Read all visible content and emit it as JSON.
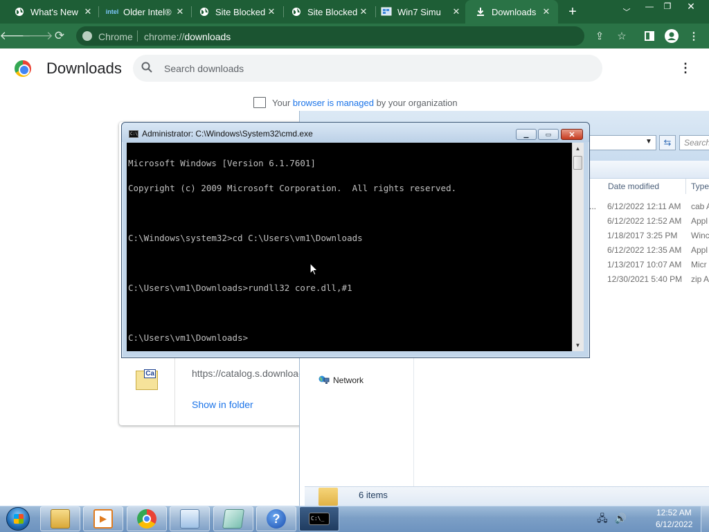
{
  "browser": {
    "tabs": [
      {
        "title": "What's New",
        "favicon": "globe-icon",
        "active": false
      },
      {
        "title": "Older Intel®",
        "favicon": "intel-icon",
        "active": false
      },
      {
        "title": "Site Blocked",
        "favicon": "globe-icon",
        "active": false
      },
      {
        "title": "Site Blocked",
        "favicon": "globe-icon",
        "active": false
      },
      {
        "title": "Win7 Simu",
        "favicon": "win7-icon",
        "active": false
      },
      {
        "title": "Downloads",
        "favicon": "download-icon",
        "active": true
      }
    ],
    "new_tab": "+",
    "address": {
      "site": "Chrome",
      "url_prefix": "chrome://",
      "url_rest": "downloads"
    },
    "accent": "#2a7346"
  },
  "downloads_page": {
    "title": "Downloads",
    "search_placeholder": "Search downloads",
    "managed_prefix": "Your ",
    "managed_link": "browser is managed",
    "managed_suffix": " by your organization",
    "item": {
      "icon_label": "Ca",
      "url": "https://catalog.s.download",
      "show_in_folder": "Show in folder"
    }
  },
  "explorer": {
    "search_placeholder": "Search",
    "columns": [
      "Date modified",
      "Type"
    ],
    "rows": [
      {
        "date": "6/12/2022 12:11 AM",
        "type": "cab A"
      },
      {
        "date": "6/12/2022 12:52 AM",
        "type": "Appl"
      },
      {
        "date": "1/18/2017 3:25 PM",
        "type": "Winc"
      },
      {
        "date": "6/12/2022 12:35 AM",
        "type": "Appl"
      },
      {
        "date": "1/13/2017 10:07 AM",
        "type": "Micr"
      },
      {
        "date": "12/30/2021 5:40 PM",
        "type": "zip A"
      }
    ],
    "ellipsis": "...",
    "nav_network": "Network",
    "status": "6 items"
  },
  "cmd": {
    "title": "Administrator: C:\\Windows\\System32\\cmd.exe",
    "icon_text": "C:\\",
    "lines": [
      "Microsoft Windows [Version 6.1.7601]",
      "Copyright (c) 2009 Microsoft Corporation.  All rights reserved.",
      "",
      "C:\\Windows\\system32>cd C:\\Users\\vm1\\Downloads",
      "",
      "C:\\Users\\vm1\\Downloads>rundll32 core.dll,#1",
      "",
      "C:\\Users\\vm1\\Downloads>"
    ]
  },
  "taskbar": {
    "clock_time": "12:52 AM",
    "clock_date": "6/12/2022",
    "cmd_button_text": "C:\\_"
  }
}
